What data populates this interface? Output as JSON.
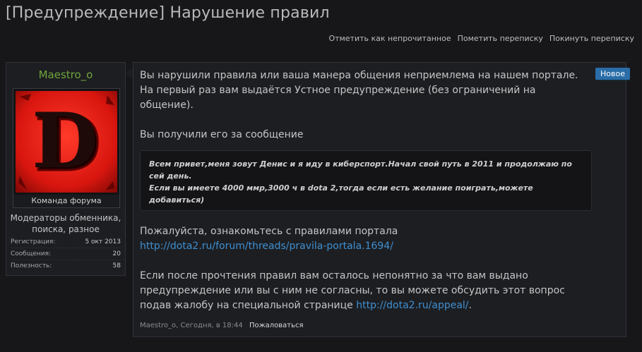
{
  "page": {
    "title": "[Предупреждение] Нарушение правил"
  },
  "actions": {
    "mark_unread": "Отметить как непрочитанное",
    "flag_conversation": "Пометить переписку",
    "leave_conversation": "Покинуть переписку"
  },
  "user": {
    "name": "Maestro_o",
    "avatar_letter": "D",
    "avatar_caption": "Команда форума",
    "title": "Модераторы обменника, поиска, разное",
    "stats": [
      {
        "label": "Регистрация:",
        "value": "5 окт 2013"
      },
      {
        "label": "Сообщения:",
        "value": "20"
      },
      {
        "label": "Полезность:",
        "value": "58"
      }
    ]
  },
  "message": {
    "badge": "Новое",
    "para1": "Вы нарушили правила или ваша манера общения неприемлема на нашем портале. На первый раз вам выдаётся Устное предупреждение (без ограничений на общение).",
    "para2": "Вы получили его за сообщение",
    "quote_line1": "Всем привет,меня зовут Денис и я иду в киберспорт.Начал свой путь в 2011 и продолжаю по сей день.",
    "quote_line2": "Если вы имеете 4000 ммр,3000 ч в dota 2,тогда если есть желание поиграть,можете добавиться)",
    "para3": "Пожалуйста, ознакомьтесь с правилами портала",
    "rules_link": "http://dota2.ru/forum/threads/pravila-portala.1694/",
    "para4": "Если после прочтения правил вам осталось непонятно за что вам выдано предупреждение или вы с ним не согласны, то вы можете обсудить этот вопрос подав жалобу на специальной странице",
    "appeal_link": "http://dota2.ru/appeal/",
    "para4_end": ".",
    "footer_meta": "Maestro_o, Сегодня, в 18:44",
    "report": "Пожаловаться"
  },
  "colors": {
    "background": "#17171a",
    "panel": "#1d1e22",
    "username": "#6fa53a",
    "link": "#3e8fd0",
    "badge": "#2a6da8",
    "avatar_red": "#e0201a"
  }
}
